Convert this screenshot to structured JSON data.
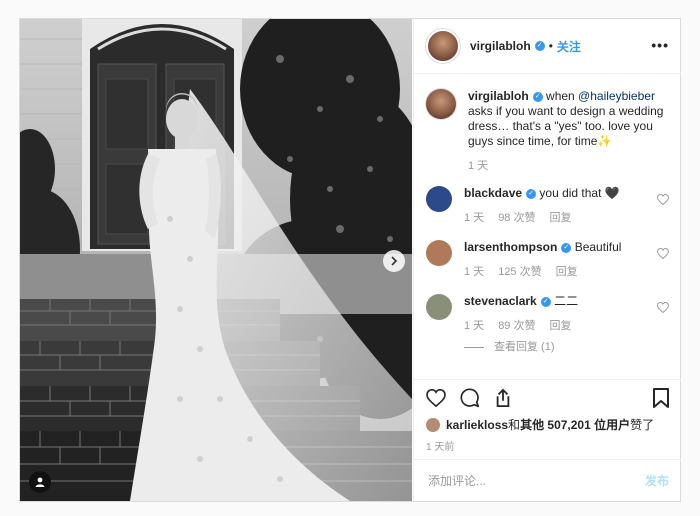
{
  "post": {
    "author": "virgilabloh",
    "follow_label": "关注",
    "dot": "•",
    "more_label": "•••"
  },
  "caption": {
    "author": "virgilabloh",
    "text_before": " when ",
    "mention": "@haileybieber",
    "text_after": " asks if you want to design a wedding dress… that's a \"yes\" too. love you guys since time, for time✨",
    "time": "1 天"
  },
  "comments": [
    {
      "author": "blackdave",
      "text": "you did that 🖤",
      "time": "1 天",
      "likes": "98 次赞",
      "reply": "回复",
      "avatar_color": "#2c4a8a"
    },
    {
      "author": "larsenthompson",
      "text": "Beautiful",
      "time": "1 天",
      "likes": "125 次赞",
      "reply": "回复",
      "avatar_color": "#b07a5a"
    },
    {
      "author": "stevenaclark",
      "text": "二二",
      "time": "1 天",
      "likes": "89 次赞",
      "reply": "回复",
      "avatar_color": "#8a8f7a"
    }
  ],
  "view_replies": "查看回复 (1)",
  "likes": {
    "user": "karliekloss",
    "connector": " 和 ",
    "others_label": "其他 507,201 位用户",
    "suffix": " 赞了"
  },
  "post_time": "1 天前",
  "composer": {
    "placeholder": "添加评论...",
    "post_label": "发布"
  },
  "colors": {
    "accent": "#3897f0",
    "post_disabled": "#b2dffc",
    "muted": "#999999"
  },
  "icons": [
    "heart-icon",
    "comment-icon",
    "share-icon",
    "bookmark-icon",
    "chevron-right-icon",
    "user-tag-icon",
    "verified-badge-icon"
  ]
}
